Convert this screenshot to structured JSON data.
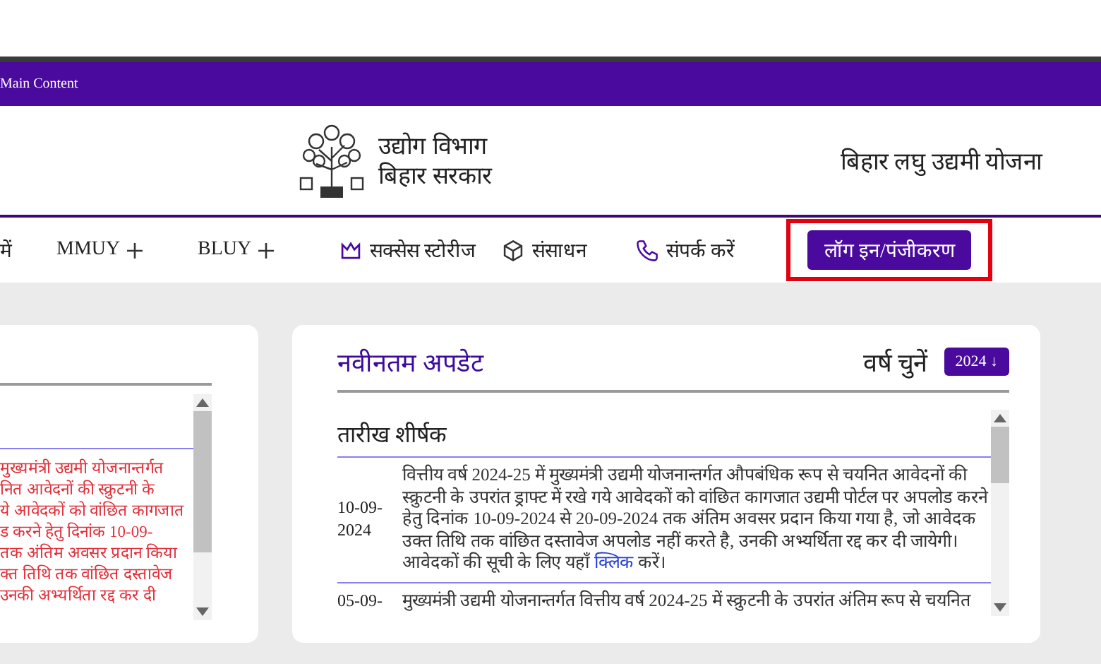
{
  "skip_bar": {
    "label": "Main Content"
  },
  "header": {
    "department": "उद्योग विभाग",
    "government": "बिहार सरकार",
    "scheme": "बिहार लघु उद्यमी योजना"
  },
  "nav": {
    "items": [
      {
        "label": "में",
        "kind": "text"
      },
      {
        "label": "MMUY",
        "kind": "expand"
      },
      {
        "label": "BLUY",
        "kind": "expand"
      },
      {
        "label": "सक्सेस स्टोरीज",
        "kind": "crown"
      },
      {
        "label": "संसाधन",
        "kind": "cube"
      },
      {
        "label": "संपर्क करें",
        "kind": "phone"
      }
    ],
    "login": "लॉग इन/पंजीकरण"
  },
  "left_card": {
    "lines": [
      "मुख्यमंत्री उद्यमी योजनान्तर्गत",
      "नित आवेदनों की स्क्रुटनी के",
      "ये आवेदकों को वांछित कागजात",
      "ड करने हेतु दिनांक 10-09-",
      "तक अंतिम अवसर प्रदान किया",
      "क्त तिथि तक वांछित दस्तावेज",
      "उनकी अभ्यर्थिता रद्द कर दी"
    ]
  },
  "updates": {
    "title": "नवीनतम अपडेट",
    "year_label": "वर्ष चुनें",
    "year": "2024 ↓",
    "columns": [
      "तारीख",
      "शीर्षक"
    ],
    "rows": [
      {
        "date": "10-09-2024",
        "text": "वित्तीय वर्ष 2024-25 में मुख्यमंत्री उद्यमी योजनान्तर्गत औपबंधिक रूप से चयनित आवेदनों की स्क्रुटनी के उपरांत ड्राफ्ट में रखे गये आवेदकों को वांछित कागजात उद्यमी पोर्टल पर अपलोड करने हेतु दिनांक 10-09-2024 से 20-09-2024 तक अंतिम अवसर प्रदान किया गया है, जो आवेदक उक्त तिथि तक वांछित दस्तावेज अपलोड नहीं करते है, उनकी अभ्यर्थिता रद्द कर दी जायेगी। आवेदकों की सूची के लिए यहाँ",
        "link": "क्लिक",
        "after": "करें।"
      },
      {
        "date": "05-09-",
        "text": "मुख्यमंत्री उद्यमी योजनान्तर्गत वित्तीय वर्ष 2024-25 में स्क्रुटनी के उपरांत अंतिम रूप से चयनित",
        "link": "",
        "after": ""
      }
    ]
  }
}
